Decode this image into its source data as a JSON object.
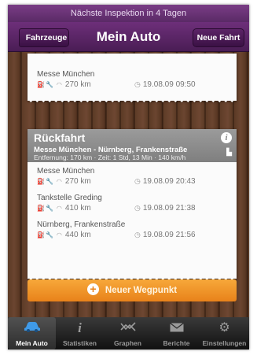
{
  "banner": {
    "text": "Nächste Inspektion in 4 Tagen"
  },
  "navbar": {
    "title": "Mein Auto",
    "back_label": "Fahrzeuge",
    "right_label": "Neue Fahrt"
  },
  "top_entry": {
    "name": "Messe München",
    "distance": "270 km",
    "time": "19.08.09 09:50"
  },
  "trip": {
    "title": "Rückfahrt",
    "route": "Messe München - Nürnberg, Frankenstraße",
    "details": "Entfernung: 170 km · Zeit: 1 Std, 13 Min · 140 km/h",
    "entries": [
      {
        "name": "Messe München",
        "distance": "270 km",
        "time": "19.08.09 20:43"
      },
      {
        "name": "Tankstelle Greding",
        "distance": "410 km",
        "time": "19.08.09 21:38"
      },
      {
        "name": "Nürnberg, Frankenstraße",
        "distance": "440 km",
        "time": "19.08.09 21:56"
      }
    ]
  },
  "add_waypoint_label": "Neuer Wegpunkt",
  "tabs": [
    {
      "label": "Mein Auto",
      "icon": "car-icon",
      "active": true
    },
    {
      "label": "Statistiken",
      "icon": "info-icon",
      "active": false
    },
    {
      "label": "Graphen",
      "icon": "graph-icon",
      "active": false
    },
    {
      "label": "Berichte",
      "icon": "mail-icon",
      "active": false
    },
    {
      "label": "Einstellungen",
      "icon": "gear-icon",
      "active": false
    }
  ],
  "colors": {
    "navbar": "#5a2a66",
    "orange_button": "#f0951f",
    "active_tab_icon": "#3f9ae8"
  }
}
